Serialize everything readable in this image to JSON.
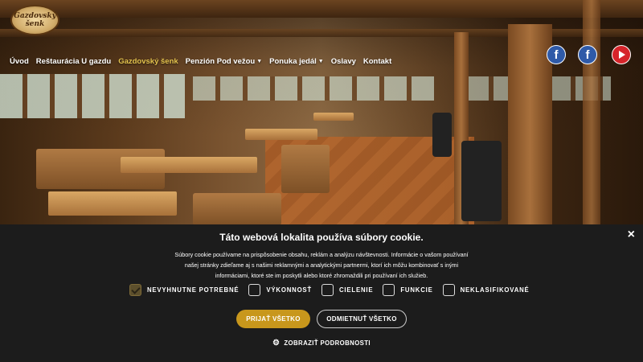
{
  "logo": {
    "line1": "Gazdovský",
    "line2": "šenk"
  },
  "nav": {
    "items": [
      {
        "label": "Úvod",
        "active": false,
        "dropdown": false
      },
      {
        "label": "Reštaurácia U gazdu",
        "active": false,
        "dropdown": false
      },
      {
        "label": "Gazdovský šenk",
        "active": true,
        "dropdown": false
      },
      {
        "label": "Penzión Pod vežou",
        "active": false,
        "dropdown": true
      },
      {
        "label": "Ponuka jedál",
        "active": false,
        "dropdown": true
      },
      {
        "label": "Oslavy",
        "active": false,
        "dropdown": false
      },
      {
        "label": "Kontakt",
        "active": false,
        "dropdown": false
      }
    ]
  },
  "social": [
    {
      "icon": "facebook-icon",
      "glyph": "f"
    },
    {
      "icon": "facebook-icon",
      "glyph": "f"
    },
    {
      "icon": "youtube-icon"
    }
  ],
  "cookie": {
    "title": "Táto webová lokalita používa súbory cookie.",
    "text": "Súbory cookie používame na prispôsobenie obsahu, reklám a analýzu návštevnosti. Informácie o vašom používaní našej stránky zdieľame aj s našimi reklamnými a analytickými partnermi, ktorí ich môžu kombinovať s inými informáciami, ktoré ste im poskytli alebo ktoré zhromaždili pri používaní ich služieb.",
    "close": "×",
    "options": [
      {
        "label": "NEVYHNUTNE POTREBNÉ",
        "checked": true
      },
      {
        "label": "VÝKONNOSŤ",
        "checked": false
      },
      {
        "label": "CIELENIE",
        "checked": false
      },
      {
        "label": "FUNKCIE",
        "checked": false
      },
      {
        "label": "NEKLASIFIKOVANÉ",
        "checked": false
      }
    ],
    "accept_label": "PRIJAŤ VŠETKO",
    "reject_label": "ODMIETNUŤ VŠETKO",
    "details_label": "ZOBRAZIŤ PODROBNOSTI",
    "details_icon": "gear-icon"
  },
  "colors": {
    "accent": "#c8971c",
    "active_nav": "#e3c24d",
    "panel": "#1c1c1c"
  }
}
